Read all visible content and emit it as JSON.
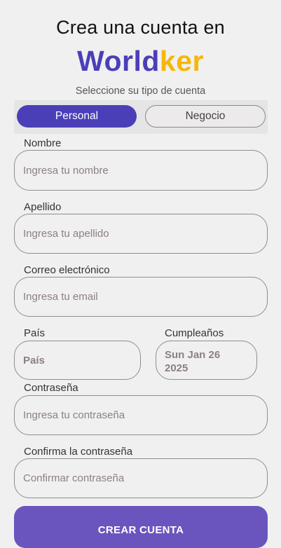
{
  "header": {
    "title": "Crea una cuenta en",
    "brand_part1": "World",
    "brand_part2": "ker",
    "subtitle": "Seleccione su tipo de cuenta"
  },
  "account_type": {
    "options": [
      "Personal",
      "Negocio"
    ],
    "selected": "Personal"
  },
  "form": {
    "nombre": {
      "label": "Nombre",
      "placeholder": "Ingresa tu nombre"
    },
    "apellido": {
      "label": "Apellido",
      "placeholder": "Ingresa tu apellido"
    },
    "correo": {
      "label": "Correo electrónico",
      "placeholder": "Ingresa tu email"
    },
    "pais": {
      "label": "País",
      "value": "País"
    },
    "cumpleanos": {
      "label": "Cumpleaños",
      "value_line1": "Sun Jan 26",
      "value_line2": "2025"
    },
    "contrasena": {
      "label": "Contraseña",
      "placeholder": "Ingresa tu contraseña"
    },
    "confirmar": {
      "label": "Confirma la contraseña",
      "placeholder": "Confirmar contraseña"
    }
  },
  "submit_label": "CREAR CUENTA",
  "colors": {
    "primary": "#4b3fb8",
    "brand_accent": "#f5b70a",
    "button": "#6a55be",
    "background": "#f1f0f1"
  }
}
